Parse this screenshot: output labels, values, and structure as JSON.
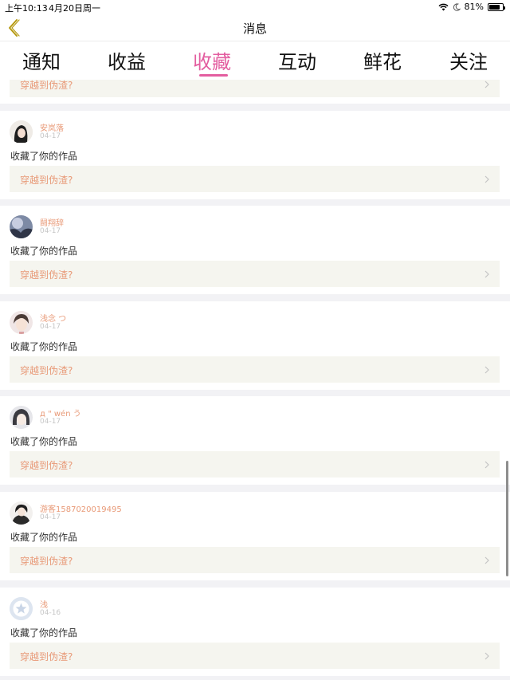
{
  "status_bar": {
    "time": "上午10:13",
    "date": "4月20日周一",
    "battery": "81%",
    "battery_level": 0.81
  },
  "header": {
    "title": "消息"
  },
  "tabs": [
    {
      "label": "通知",
      "active": false
    },
    {
      "label": "收益",
      "active": false
    },
    {
      "label": "收藏",
      "active": true
    },
    {
      "label": "互动",
      "active": false
    },
    {
      "label": "鲜花",
      "active": false
    },
    {
      "label": "关注",
      "active": false
    }
  ],
  "accent_color": "#e35ea0",
  "partial_item": {
    "work_title": "穿越到伪渣?"
  },
  "items": [
    {
      "user": "安岚落",
      "date": "04-17",
      "action": "收藏了你的作品",
      "work_title": "穿越到伪渣?"
    },
    {
      "user": "鬪翔辞",
      "date": "04-17",
      "action": "收藏了你的作品",
      "work_title": "穿越到伪渣?"
    },
    {
      "user": "浅念 つ",
      "date": "04-17",
      "action": "收藏了你的作品",
      "work_title": "穿越到伪渣?"
    },
    {
      "user": "д \" wén う",
      "date": "04-17",
      "action": "收藏了你的作品",
      "work_title": "穿越到伪渣?"
    },
    {
      "user": "游客1587020019495",
      "date": "04-17",
      "action": "收藏了你的作品",
      "work_title": "穿越到伪渣?"
    },
    {
      "user": "浅",
      "date": "04-16",
      "action": "收藏了你的作品",
      "work_title": "穿越到伪渣?"
    }
  ]
}
